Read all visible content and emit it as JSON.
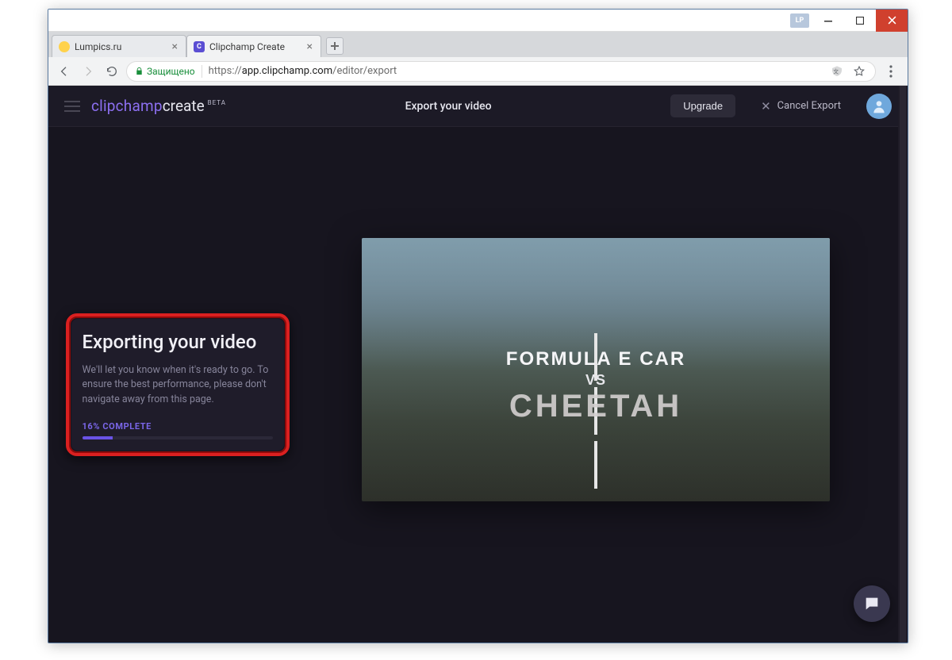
{
  "os_window": {
    "user_badge": "LP"
  },
  "tabs": [
    {
      "title": "Lumpics.ru",
      "favicon": "lumpics"
    },
    {
      "title": "Clipchamp Create",
      "favicon": "clipchamp"
    }
  ],
  "address": {
    "secure_label": "Защищено",
    "scheme": "https://",
    "host": "app.clipchamp.com",
    "path": "/editor/export"
  },
  "app": {
    "brand_part1": "clipchamp",
    "brand_part2": "create",
    "brand_badge": "BETA",
    "header_title": "Export your video",
    "upgrade_label": "Upgrade",
    "cancel_label": "Cancel Export"
  },
  "export_card": {
    "heading": "Exporting your video",
    "body": "We'll let you know when it's ready to go. To ensure the best performance, please don't navigate away from this page.",
    "progress_label": "16% COMPLETE",
    "progress_percent": 16
  },
  "video_preview": {
    "line1": "FORMULA E CAR",
    "line2": "VS",
    "line3": "CHEETAH"
  }
}
